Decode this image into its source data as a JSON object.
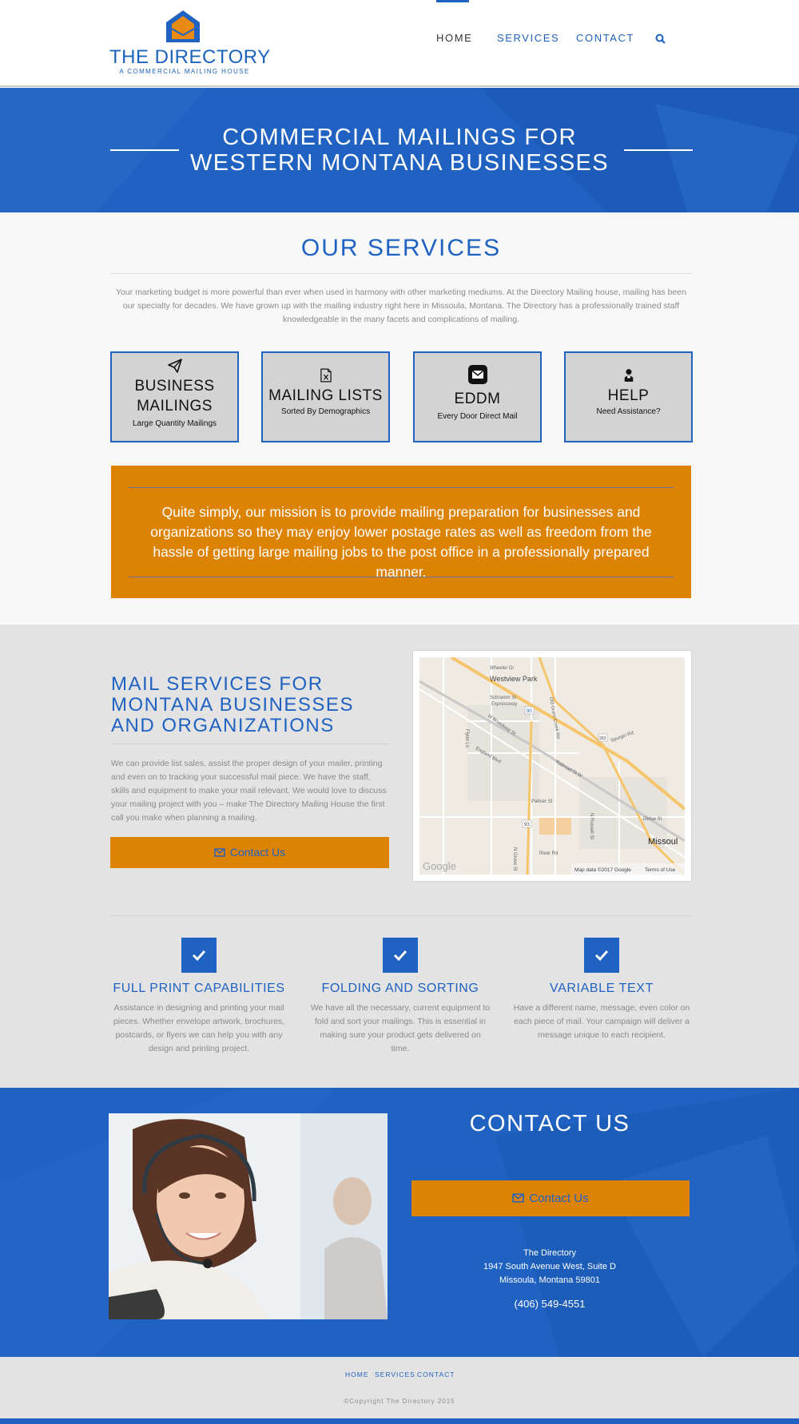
{
  "header": {
    "logo": {
      "title": "THE DIRECTORY",
      "subtitle": "A COMMERCIAL MAILING HOUSE"
    },
    "nav": [
      {
        "label": "HOME",
        "active": true
      },
      {
        "label": "SERVICES"
      },
      {
        "label": "CONTACT"
      }
    ],
    "search_icon": "search-icon"
  },
  "hero": {
    "title_line1": "COMMERCIAL MAILINGS FOR",
    "title_line2": "WESTERN MONTANA BUSINESSES"
  },
  "services": {
    "title": "OUR SERVICES",
    "intro": "Your marketing budget is more powerful than ever when used in harmony with other marketing mediums. At the Directory Mailing house, mailing has been our specialty for decades. We have grown up with the mailing industry right here in Missoula, Montana. The Directory has a professionally trained staff knowledgeable in the many facets and complications of mailing.",
    "cards": [
      {
        "title": "BUSINESS MAILINGS",
        "subtitle": "Large Quantity Mailings",
        "icon": "paper-plane-icon"
      },
      {
        "title": "MAILING LISTS",
        "subtitle": "Sorted By Demographics",
        "icon": "excel-file-icon"
      },
      {
        "title": "EDDM",
        "subtitle": "Every Door Direct Mail",
        "icon": "envelope-square-icon"
      },
      {
        "title": "HELP",
        "subtitle": "Need Assistance?",
        "icon": "user-help-icon"
      }
    ]
  },
  "mission": {
    "text": "Quite simply, our mission is to provide mailing preparation for businesses and organizations so they may enjoy lower postage rates as well as freedom from the hassle of getting large mailing jobs to the post office in a professionally prepared manner."
  },
  "mail_services": {
    "title": "MAIL SERVICES FOR MONTANA BUSINESSES AND ORGANIZATIONS",
    "text": "We can provide list sales, assist the proper design of your mailer, printing and even on to tracking your successful mail piece. We have the staff, skills and equipment to make your mail relevant. We would love to discuss your mailing project with you – make The Directory Mailing House the first call you make when planning a mailing.",
    "button_label": "Contact Us"
  },
  "map": {
    "labels": {
      "westview_park": "Westview Park",
      "wheeler_dr": "Wheeler Dr",
      "expressway": "Expressway",
      "schramm_st": "Schramm St",
      "w_broadway_st": "W Broadway St",
      "old_grant_creek": "Old Grant Creek Rd",
      "spurgin_rd": "Spurgin Rd",
      "flynn_ln": "Flynn Ln",
      "england_blvd": "England Blvd",
      "palmer_st": "Palmer St",
      "russell_st": "N Russell St",
      "defoe_st": "Defoe St",
      "river_rd": "River Rd",
      "grove_st": "N Grove St",
      "missoula": "Missoul",
      "railroad_st": "Railroad St W",
      "interstate_90": "90",
      "hwy_93": "93",
      "route_263": "263"
    },
    "attribution": "Map data ©2017 Google",
    "terms": "Terms of Use",
    "google": "Google"
  },
  "features": [
    {
      "title": "FULL PRINT CAPABILITIES",
      "text": "Assistance in designing and printing your mail pieces. Whether envelope artwork, brochures, postcards, or flyers we can help you with any design and printing project."
    },
    {
      "title": "FOLDING AND SORTING",
      "text": "We have all the necessary, current equipment to fold and sort your mailings. This is essential in making sure your product gets delivered on time."
    },
    {
      "title": "VARIABLE TEXT",
      "text": "Have a different name, message, even color on each piece of mail. Your campaign will deliver a message unique to each recipient."
    }
  ],
  "contact": {
    "title": "CONTACT US",
    "button_label": "Contact Us",
    "address_name": "The Directory",
    "address_line1": "1947 South Avenue West, Suite D",
    "address_line2": "Missoula, Montana 59801",
    "phone": "(406) 549-4551"
  },
  "footer": {
    "links": [
      "HOME",
      "SERVICES",
      "CONTACT"
    ],
    "copyright": "©Copyright The Directory 2015"
  },
  "colors": {
    "brand_blue": "#1f62c1",
    "accent_orange": "#dd8304",
    "section_grey": "#e3e3e3"
  }
}
